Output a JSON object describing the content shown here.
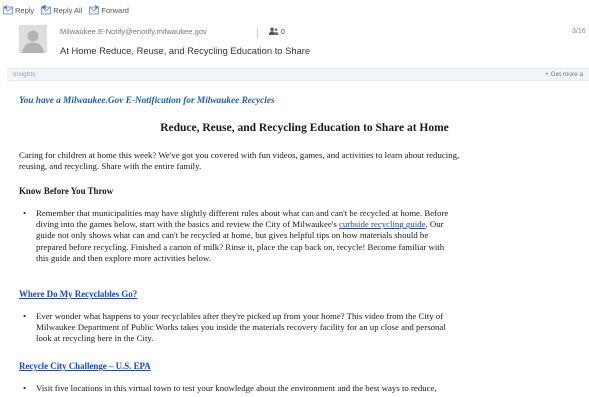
{
  "toolbar": {
    "reply": "Reply",
    "reply_all": "Reply All",
    "forward": "Forward"
  },
  "header": {
    "sender": "Milwaukee.E-Notify@enotify.milwaukee.gov",
    "people_count": "0",
    "date": "3/16",
    "subject": "At Home Reduce, Reuse, and Recycling Education to Share"
  },
  "insights": {
    "label": "Insights",
    "get_more": "+  Get more a"
  },
  "body": {
    "notification": "You have a Milwaukee.Gov E-Notification for Milwaukee Recycles",
    "title": "Reduce, Reuse, and Recycling Education to Share at Home",
    "intro_lines": [
      "Caring for children at home this week? We've got you covered with fun videos, games, and activities to learn about reducing,",
      "reusing, and recycling. Share with the entire family."
    ],
    "section1": {
      "heading": "Know Before You Throw",
      "line1": "Remember that municipalities may have slightly different rules about what can and can't be recycled at home. Before",
      "line2_pre": "diving into the games below, start with the basics and review the City of Milwaukee's ",
      "line2_link": "curbside recycling guide",
      "line2_post": ". Our",
      "line3": "guide not only shows what can and can't be recycled at home, but gives helpful tips on how materials should be",
      "line4": "prepared before recycling. Finished a carton of milk? Rinse it, place the cap back on, recycle! Become familiar with",
      "line5": "this guide and then explore more activities below."
    },
    "section2": {
      "heading": "Where Do My Recyclables Go?",
      "line1": "Ever wonder what happens to your recyclables after they're picked up from your home? This video from the City of",
      "line2": "Milwaukee Department of Public Works takes you inside the materials recovery facility for an up close and personal",
      "line3": "look at recycling here in the City."
    },
    "section3": {
      "heading": "Recycle City Challenge – U.S. EPA",
      "line1": "Visit five locations in this virtual town to test your knowledge about the environment and the best ways to reduce,"
    }
  }
}
